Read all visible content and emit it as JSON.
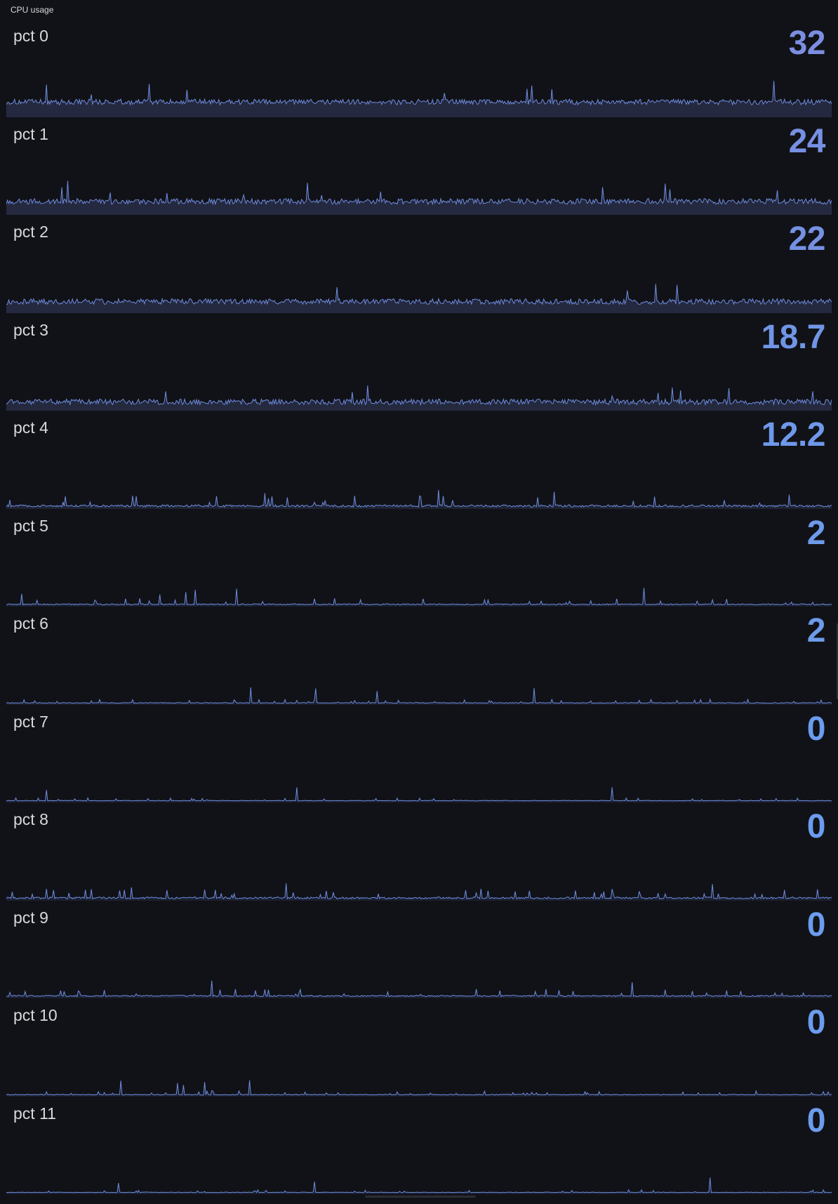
{
  "panel": {
    "title": "CPU usage"
  },
  "rows": [
    {
      "label": "pct 0",
      "value": "32",
      "value_color": "#7c8ee0",
      "area_fill": "#25293f",
      "level": 0.3,
      "style": "band"
    },
    {
      "label": "pct 1",
      "value": "24",
      "value_color": "#7690e2",
      "area_fill": "#25293f",
      "level": 0.26,
      "style": "band"
    },
    {
      "label": "pct 2",
      "value": "22",
      "value_color": "#7690e2",
      "area_fill": "#25293f",
      "level": 0.22,
      "style": "band"
    },
    {
      "label": "pct 3",
      "value": "18.7",
      "value_color": "#7195e6",
      "area_fill": "#24293e",
      "level": 0.16,
      "style": "band"
    },
    {
      "label": "pct 4",
      "value": "12.2",
      "value_color": "#6e98ea",
      "area_fill": "#1f2434",
      "level": 0.06,
      "style": "spiky"
    },
    {
      "label": "pct 5",
      "value": "2",
      "value_color": "#6e9aea",
      "area_fill": "#1b2030",
      "level": 0.03,
      "style": "spiky"
    },
    {
      "label": "pct 6",
      "value": "2",
      "value_color": "#6e9aea",
      "area_fill": "#1b2030",
      "level": 0.02,
      "style": "spiky"
    },
    {
      "label": "pct 7",
      "value": "0",
      "value_color": "#6b9cee",
      "area_fill": "#1b2030",
      "level": 0.015,
      "style": "spiky"
    },
    {
      "label": "pct 8",
      "value": "0",
      "value_color": "#6b9cee",
      "area_fill": "#1b2030",
      "level": 0.05,
      "style": "spiky"
    },
    {
      "label": "pct 9",
      "value": "0",
      "value_color": "#6b9cee",
      "area_fill": "#1b2030",
      "level": 0.035,
      "style": "spiky"
    },
    {
      "label": "pct 10",
      "value": "0",
      "value_color": "#6b9cee",
      "area_fill": "#1b2030",
      "level": 0.02,
      "style": "spiky"
    },
    {
      "label": "pct 11",
      "value": "0",
      "value_color": "#6b9cee",
      "area_fill": "#1b2030",
      "level": 0.015,
      "style": "spiky"
    }
  ],
  "colors": {
    "background": "#111217",
    "line": "#6e8ce0",
    "text": "#d8d9da"
  }
}
